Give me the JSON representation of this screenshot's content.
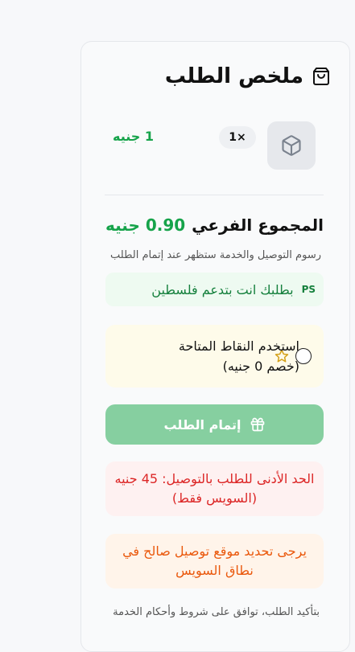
{
  "summary": {
    "title": "ملخص الطلب",
    "icon": "shopping-bag-icon"
  },
  "item": {
    "thumbnail_icon": "package-icon",
    "quantity": "1×",
    "price": "1 جنيه"
  },
  "subtotal": {
    "label": "المجموع الفرعي",
    "value": "0.90 جنيه",
    "fees_note": "رسوم التوصيل والخدمة ستظهر عند إتمام الطلب"
  },
  "banner": {
    "badge": "PS",
    "text": "بطلبك انت بتدعم فلسطين"
  },
  "points": {
    "line1": "استخدم النقاط المتاحة",
    "line2": "(خصم 0 جنيه)",
    "checked": false
  },
  "checkout": {
    "label": "إتمام الطلب",
    "enabled": false
  },
  "warnings": {
    "min_order": "الحد الأدنى للطلب بالتوصيل: 45 جنيه (السويس فقط)",
    "location": "يرجى تحديد موقع توصيل صالح في نطاق السويس"
  },
  "terms": "بتأكيد الطلب، توافق على شروط وأحكام الخدمة",
  "colors": {
    "accent_green": "#16a34a",
    "button_disabled": "#86cfa0",
    "error": "#dc2626",
    "warning": "#ea580c"
  }
}
